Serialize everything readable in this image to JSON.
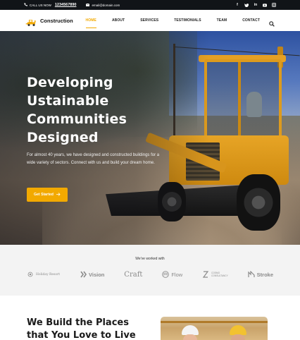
{
  "topbar": {
    "call_label": "CALL US NOW",
    "phone": "1234567890",
    "email": "email@domain.com",
    "social": [
      "facebook-icon",
      "twitter-icon",
      "linkedin-icon",
      "youtube-icon",
      "instagram-icon"
    ]
  },
  "nav": {
    "brand": "Construction",
    "items": [
      {
        "label": "HOME",
        "active": true
      },
      {
        "label": "ABOUT",
        "active": false
      },
      {
        "label": "SERVICES",
        "active": false
      },
      {
        "label": "TESTIMONIALS",
        "active": false
      },
      {
        "label": "TEAM",
        "active": false
      },
      {
        "label": "CONTACT",
        "active": false
      }
    ]
  },
  "hero": {
    "title_lines": [
      "Developing",
      "Ustainable",
      "Communities",
      "Designed"
    ],
    "description": "For almost 40 years, we have designed and constructed buildings for a wide variety of sectors. Connect with us and build your dream home.",
    "cta_label": "Get Started"
  },
  "partners": {
    "title": "We've worked with",
    "logos": [
      "Holiday Resort",
      "Vision",
      "Craft",
      "Flow",
      "COSMO",
      "Stroke"
    ],
    "cosmo_sub": "CONSULTANCY"
  },
  "section": {
    "title": "We Build the Places that You Love to Live and"
  },
  "colors": {
    "accent": "#f2a900",
    "topbar": "#111418",
    "partners_bg": "#f3f3f3"
  }
}
